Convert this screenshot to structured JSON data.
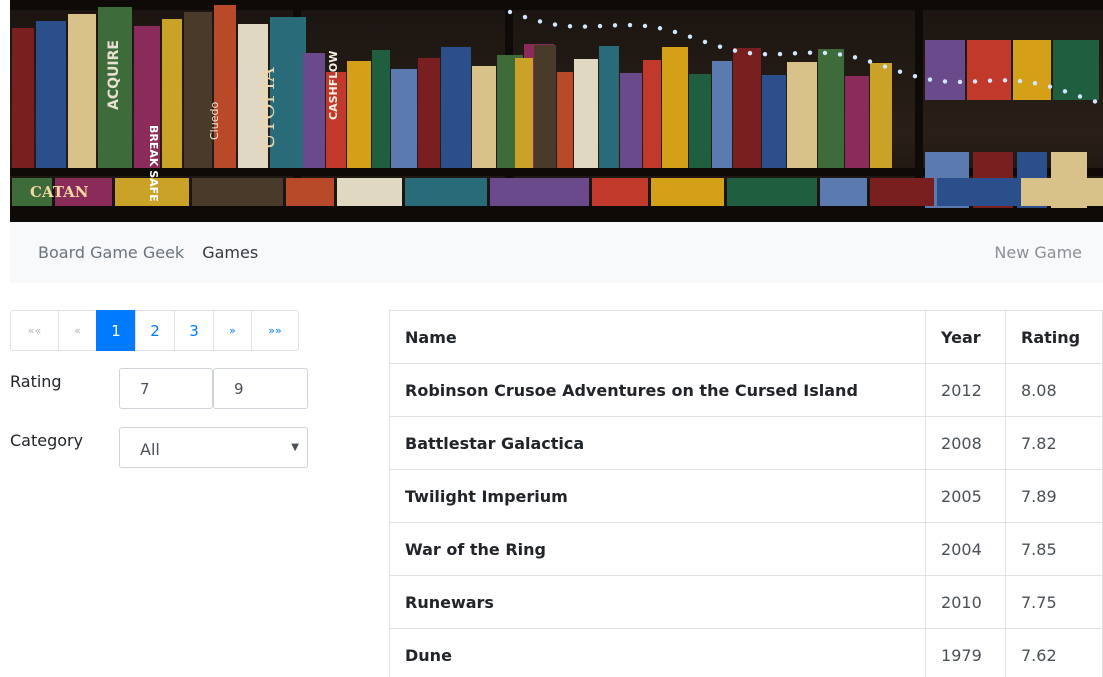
{
  "navbar": {
    "brand": "Board Game Geek",
    "active_link": "Games",
    "new_game": "New Game"
  },
  "pagination": {
    "first": "««",
    "prev": "«",
    "pages": [
      "1",
      "2",
      "3"
    ],
    "active_page": "1",
    "next": "»",
    "last": "»»"
  },
  "filters": {
    "rating_label": "Rating",
    "rating_min": "7",
    "rating_max": "9",
    "category_label": "Category",
    "category_value": "All"
  },
  "table": {
    "headers": [
      "Name",
      "Year",
      "Rating"
    ],
    "rows": [
      {
        "name": "Robinson Crusoe Adventures on the Cursed Island",
        "year": "2012",
        "rating": "8.08"
      },
      {
        "name": "Battlestar Galactica",
        "year": "2008",
        "rating": "7.82"
      },
      {
        "name": "Twilight Imperium",
        "year": "2005",
        "rating": "7.89"
      },
      {
        "name": "War of the Ring",
        "year": "2004",
        "rating": "7.85"
      },
      {
        "name": "Runewars",
        "year": "2010",
        "rating": "7.75"
      },
      {
        "name": "Dune",
        "year": "1979",
        "rating": "7.62"
      }
    ]
  },
  "hero": {
    "box_labels": [
      "ACQUIRE",
      "BREAK SAFE",
      "CASHFLOW",
      "CATAN",
      "Cluedo",
      "UTOPIA"
    ]
  }
}
